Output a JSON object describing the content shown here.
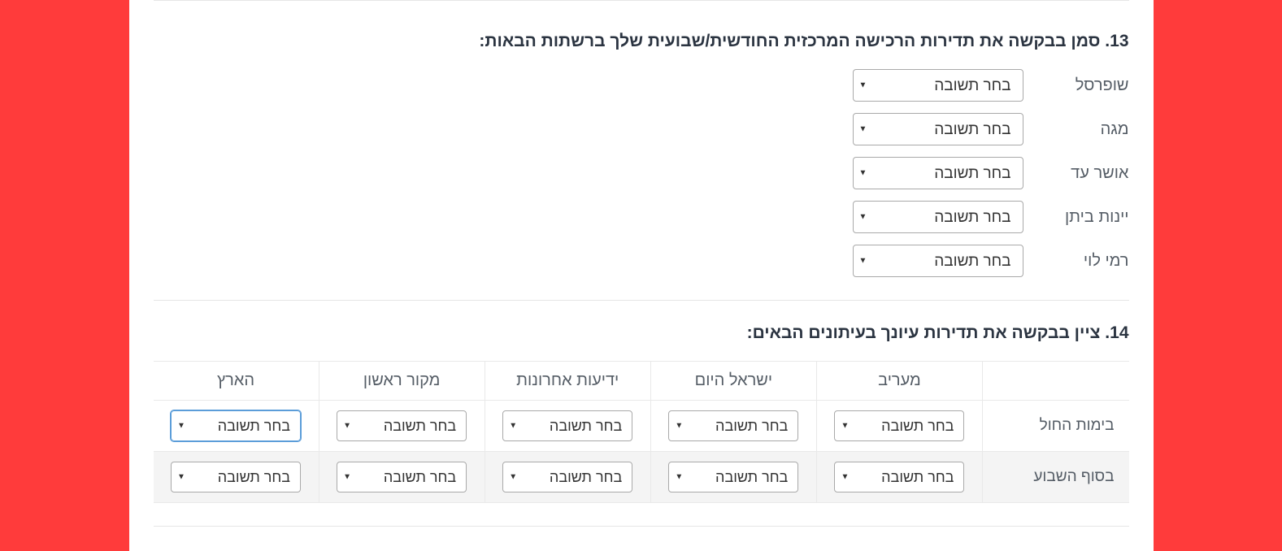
{
  "select_default": "בחר תשובה",
  "q13": {
    "title": "13. סמן בבקשה את תדירות הרכישה המרכזית החודשית/שבועית שלך ברשתות הבאות:",
    "rows": [
      {
        "label": "שופרסל"
      },
      {
        "label": "מגה"
      },
      {
        "label": "אושר עד"
      },
      {
        "label": "יינות ביתן"
      },
      {
        "label": "רמי לוי"
      }
    ]
  },
  "q14": {
    "title": "14. ציין בבקשה את תדירות עיונך בעיתונים הבאים:",
    "columns": [
      "מעריב",
      "ישראל היום",
      "ידיעות אחרונות",
      "מקור ראשון",
      "הארץ"
    ],
    "rows": [
      {
        "label": "בימות החול"
      },
      {
        "label": "בסוף השבוע"
      }
    ]
  }
}
